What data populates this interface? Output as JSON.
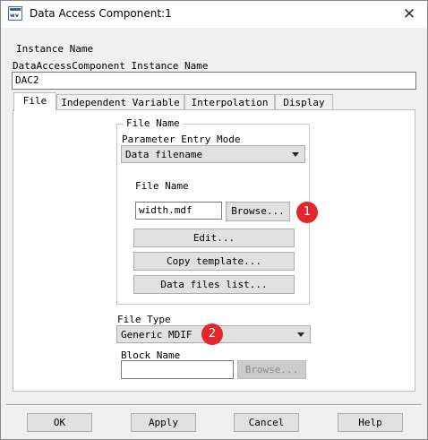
{
  "window": {
    "title": "Data Access Component:1",
    "app_icon": "ads-schematic-icon",
    "close_glyph": "✕"
  },
  "instance": {
    "section_label": "Instance Name",
    "field_label": "DataAccessComponent Instance Name",
    "value": "DAC2"
  },
  "tabs": [
    {
      "label": "File",
      "active": true
    },
    {
      "label": "Independent Variable",
      "active": false
    },
    {
      "label": "Interpolation",
      "active": false
    },
    {
      "label": "Display",
      "active": false
    }
  ],
  "file_panel": {
    "group_label": "File Name",
    "entry_mode_label": "Parameter Entry Mode",
    "entry_mode_value": "Data filename",
    "file_name_label": "File Name",
    "file_name_value": "width.mdf",
    "browse_label": "Browse...",
    "edit_label": "Edit...",
    "copy_template_label": "Copy template...",
    "data_files_list_label": "Data files list...",
    "file_type_label": "File Type",
    "file_type_value": "Generic MDIF",
    "block_name_label": "Block Name",
    "block_name_value": "",
    "block_browse_label": "Browse..."
  },
  "annotations": [
    {
      "number": "1",
      "color": "#e4262c"
    },
    {
      "number": "2",
      "color": "#e4262c"
    }
  ],
  "footer": {
    "ok": "OK",
    "apply": "Apply",
    "cancel": "Cancel",
    "help": "Help"
  }
}
